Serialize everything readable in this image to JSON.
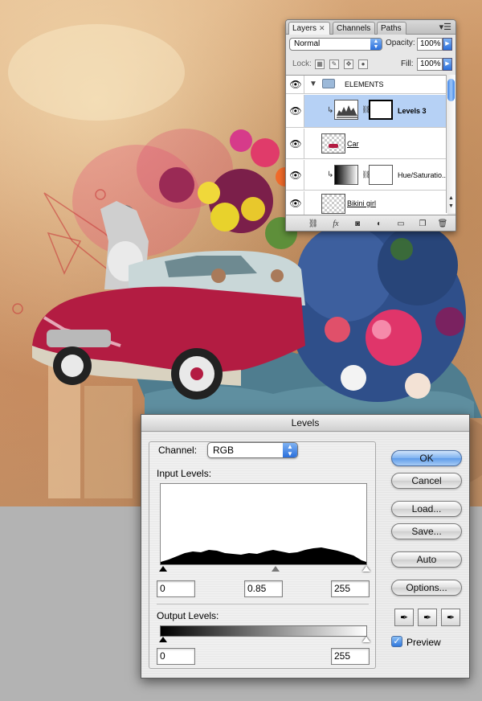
{
  "layers_panel": {
    "tabs": [
      {
        "label": "Layers",
        "active": true
      },
      {
        "label": "Channels",
        "active": false
      },
      {
        "label": "Paths",
        "active": false
      }
    ],
    "blend_mode": "Normal",
    "opacity_label": "Opacity:",
    "opacity_value": "100%",
    "lock_label": "Lock:",
    "fill_label": "Fill:",
    "fill_value": "100%",
    "layers": [
      {
        "name": "ELEMENTS",
        "type": "group",
        "visible": true,
        "selected": false
      },
      {
        "name": "Levels 3",
        "type": "adjustment",
        "visible": true,
        "selected": true
      },
      {
        "name": "Car",
        "type": "pixel",
        "visible": true,
        "selected": false
      },
      {
        "name": "Hue/Saturatio...",
        "type": "adjustment",
        "visible": true,
        "selected": false
      },
      {
        "name": "Bikini girl",
        "type": "pixel",
        "visible": true,
        "selected": false
      }
    ]
  },
  "levels_dialog": {
    "title": "Levels",
    "channel_label": "Channel:",
    "channel_value": "RGB",
    "input_levels_label": "Input Levels:",
    "input_black": "0",
    "input_gamma": "0.85",
    "input_white": "255",
    "output_levels_label": "Output Levels:",
    "output_black": "0",
    "output_white": "255",
    "buttons": {
      "ok": "OK",
      "cancel": "Cancel",
      "load": "Load...",
      "save": "Save...",
      "auto": "Auto",
      "options": "Options..."
    },
    "preview_label": "Preview",
    "preview_checked": true
  },
  "icons": {
    "eye": "eye-icon",
    "folder": "folder-icon",
    "eyedropper_black": "black-eyedropper-icon",
    "eyedropper_gray": "gray-eyedropper-icon",
    "eyedropper_white": "white-eyedropper-icon"
  },
  "colors": {
    "selection_blue": "#b6d1f5",
    "default_button_blue": "#5f9ce9"
  }
}
